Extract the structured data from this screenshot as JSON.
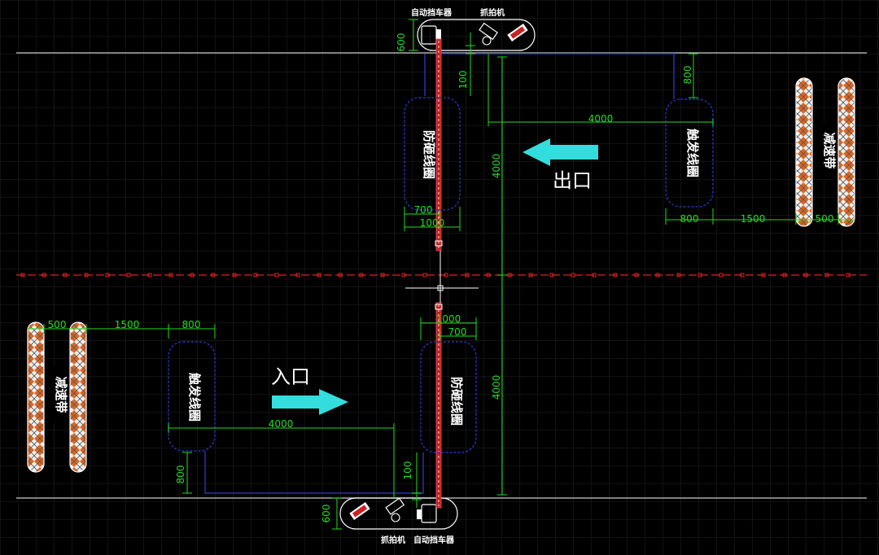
{
  "labels": {
    "barrier": "自动挡车器",
    "camera": "抓拍机",
    "anti_smash_coil": "防砸线圈",
    "trigger_coil": "触发线圈",
    "speed_bump": "减速带",
    "exit": "出口",
    "entrance": "入口"
  },
  "dimensions": {
    "d600": "600",
    "d100": "100",
    "d800": "800",
    "d4000": "4000",
    "d700": "700",
    "d1000": "1000",
    "d1500": "1500",
    "d500": "500"
  },
  "colors": {
    "background": "#000000",
    "grid": "#232323",
    "road_line": "#cccccc",
    "center_line": "#dd2222",
    "dimension": "#22dd22",
    "coil": "#2233aa",
    "arrow": "#33dddd",
    "bump_orange": "#dd6622"
  }
}
